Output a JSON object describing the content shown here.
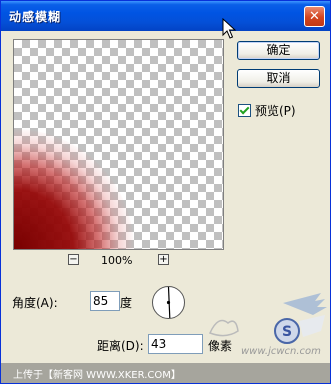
{
  "window": {
    "title": "动感模糊",
    "close_glyph": "✕"
  },
  "buttons": {
    "ok": "确定",
    "cancel": "取消"
  },
  "preview_option": {
    "label": "预览(P)",
    "checked": true
  },
  "zoom": {
    "minus": "−",
    "plus": "+",
    "level": "100%"
  },
  "angle": {
    "label": "角度(A):",
    "value": "85",
    "unit": "度"
  },
  "distance": {
    "label": "距离(D):",
    "value": "43",
    "unit": "像素"
  },
  "watermark": {
    "upload_text": "上传于【新客网 WWW.XKER.COM】",
    "site": "www.jcwcn.com"
  },
  "colors": {
    "titlebar": "#0054e3",
    "dialog_bg": "#ece9d8",
    "blur_red": "#8b0000"
  },
  "icons": {
    "close": "close-icon",
    "cursor": "mouse-pointer-icon",
    "dial": "angle-dial-icon",
    "logo": "watermark-logo-icon"
  }
}
